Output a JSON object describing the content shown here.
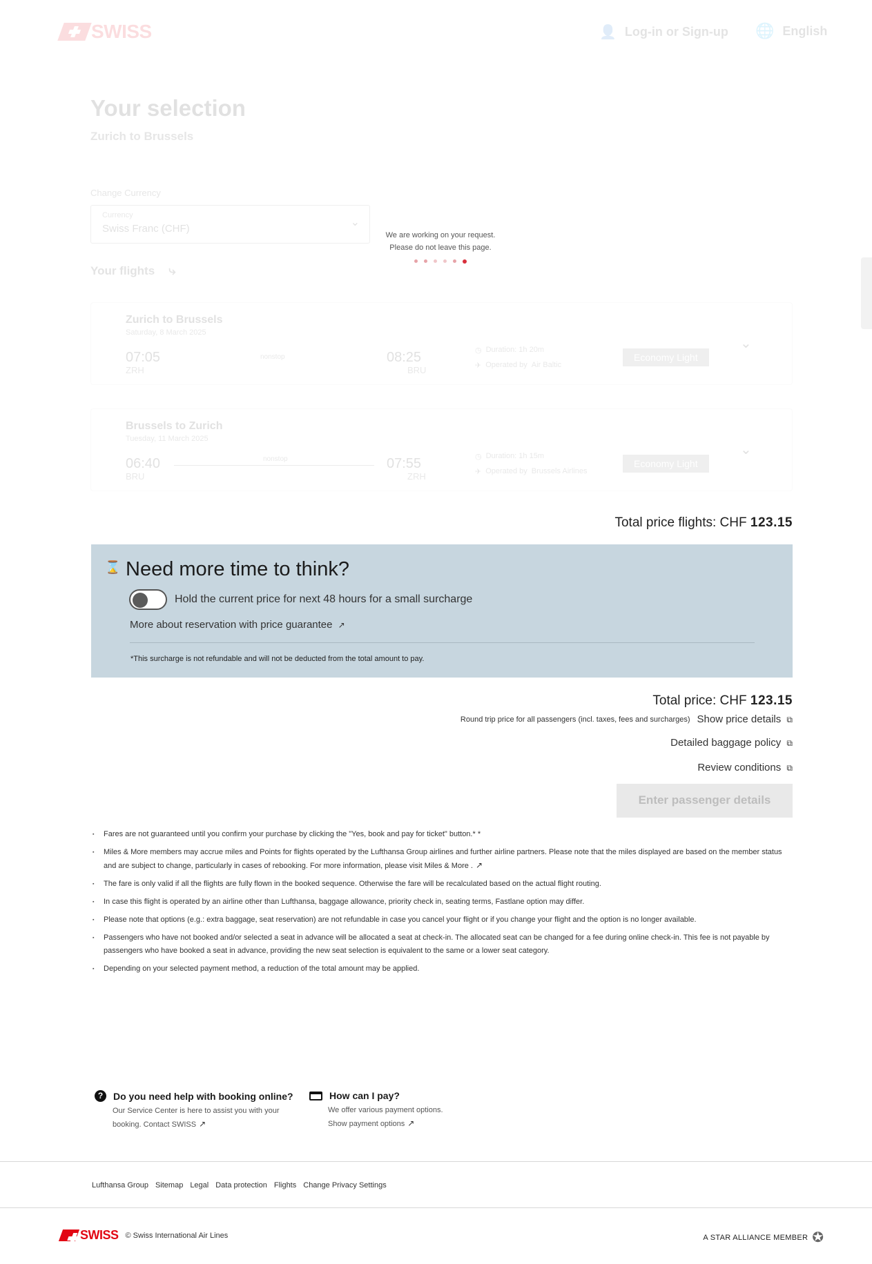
{
  "header": {
    "brand": "SWISS",
    "login_label": "Log-in or Sign-up",
    "language_label": "English"
  },
  "selection": {
    "title": "Your selection",
    "route": "Zurich to Brussels",
    "currency_heading": "Change Currency",
    "currency_field_label": "Currency",
    "currency_value": "Swiss Franc (CHF)",
    "flights_heading": "Your flights"
  },
  "loading": {
    "line1": "We are working on your request.",
    "line2": "Please do not leave this page."
  },
  "flights": [
    {
      "title": "Zurich to Brussels",
      "date": "Saturday, 8 March 2025",
      "dep_time": "07:05",
      "dep_airport": "ZRH",
      "arr_time": "08:25",
      "arr_airport": "BRU",
      "stops": "nonstop",
      "duration": "Duration: 1h 20m",
      "operated_by": "Operated by",
      "operator": "Air Baltic",
      "fare": "Economy Light"
    },
    {
      "title": "Brussels to Zurich",
      "date": "Tuesday, 11 March 2025",
      "dep_time": "06:40",
      "dep_airport": "BRU",
      "arr_time": "07:55",
      "arr_airport": "ZRH",
      "stops": "nonstop",
      "duration": "Duration: 1h 15m",
      "operated_by": "Operated by",
      "operator": "Brussels Airlines",
      "fare": "Economy Light"
    }
  ],
  "total_flights": {
    "label": "Total price flights: CHF",
    "amount": "123.15"
  },
  "think": {
    "title": "Need more time to think?",
    "toggle_label": "Hold the current price for next 48 hours for a small surcharge",
    "toggle_on": false,
    "link": "More about reservation with price guarantee",
    "note": "*This surcharge is not refundable and will not be deducted from the total amount to pay."
  },
  "total": {
    "label": "Total price: CHF",
    "amount": "123.15",
    "subtitle": "Round trip price for all passengers (incl. taxes, fees and surcharges)",
    "price_details_link": "Show price details",
    "baggage_link": "Detailed baggage policy",
    "conditions_link": "Review conditions",
    "cta": "Enter passenger details"
  },
  "notes": [
    "Fares are not guaranteed until you confirm your purchase by clicking the \"Yes, book and pay for ticket\" button.* *",
    "Miles & More members may accrue miles and Points for flights operated by the Lufthansa Group airlines and further airline partners. Please note that the miles displayed are based on the member status and are subject to change, particularly in cases of rebooking. For more information, please visit Miles & More .",
    "The fare is only valid if all the flights are fully flown in the booked sequence. Otherwise the fare will be recalculated based on the actual flight routing.",
    "In case this flight is operated by an airline other than Lufthansa, baggage allowance, priority check in, seating terms, Fastlane option may differ.",
    "Please note that options (e.g.: extra baggage, seat reservation) are not refundable in case you cancel your flight or if you change your flight and the option is no longer available.",
    "Passengers who have not booked and/or selected a seat in advance will be allocated a seat at check-in. The allocated seat can be changed for a fee during online check-in. This fee is not payable by passengers who have booked a seat in advance, providing the new seat selection is equivalent to the same or a lower seat category.",
    "Depending on your selected payment method, a reduction of the total amount may be applied."
  ],
  "help": {
    "booking_title": "Do you need help with booking online?",
    "booking_text": "Our Service Center is here to assist you with your booking.",
    "booking_link": "Contact SWISS",
    "pay_title": "How can I pay?",
    "pay_text": "We offer various payment options.",
    "pay_link": "Show payment options"
  },
  "footer": {
    "links": [
      "Lufthansa Group",
      "Sitemap",
      "Legal",
      "Data protection",
      "Flights",
      "Change Privacy Settings"
    ],
    "brand": "SWISS",
    "copyright": "©  Swiss International Air Lines",
    "alliance": "A STAR ALLIANCE MEMBER"
  },
  "colors": {
    "brand_red": "#e20613",
    "think_bg": "#c7d6df",
    "cta_disabled_bg": "#e9e9e9"
  }
}
